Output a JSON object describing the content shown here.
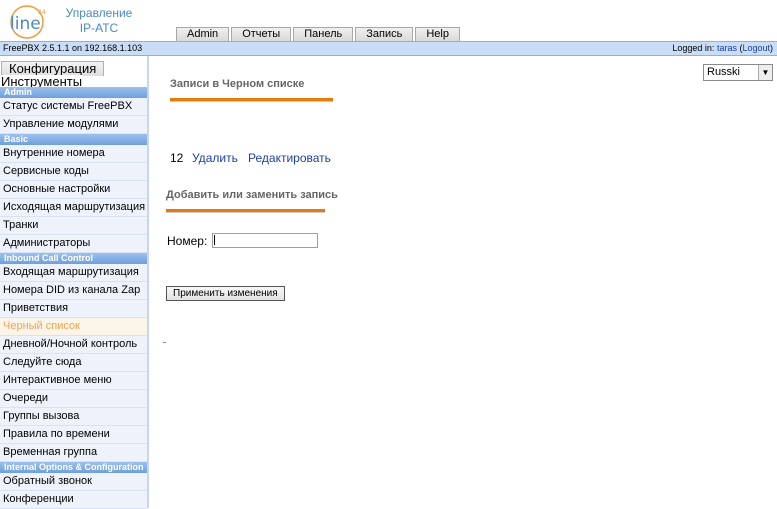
{
  "header": {
    "logo_text": "line",
    "logo_superscript": "24",
    "title_line1": "Управление",
    "title_line2": "IP-АТС",
    "tabs": [
      "Admin",
      "Отчеты",
      "Панель",
      "Запись",
      "Help"
    ]
  },
  "status_bar": {
    "version": "FreePBX 2.5.1.1 on 192.168.1.103",
    "logged_prefix": "Logged in:",
    "username": "taras",
    "logout_label": "Logout"
  },
  "sidebar": {
    "tab_config": "Конфигурация",
    "tab_tools": "Инструменты",
    "sections": [
      {
        "title": "Admin",
        "items": [
          "Статус системы FreePBX",
          "Управление модулями"
        ]
      },
      {
        "title": "Basic",
        "items": [
          "Внутренние номера",
          "Сервисные коды",
          "Основные настройки",
          "Исходящая маршрутизация",
          "Транки",
          "Администраторы"
        ]
      },
      {
        "title": "Inbound Call Control",
        "items": [
          "Входящая маршрутизация",
          "Номера DID из канала Zap",
          "Приветствия",
          "Черный список",
          "Дневной/Ночной контроль",
          "Следуйте сюда",
          "Интерактивное меню",
          "Очереди",
          "Группы вызова",
          "Правила по времени",
          "Временная группа"
        ]
      },
      {
        "title": "Internal Options & Configuration",
        "items": [
          "Обратный звонок",
          "Конференции"
        ]
      }
    ],
    "active_item": "Черный список"
  },
  "main": {
    "language": "Russki",
    "blacklist_title": "Записи в Черном списке",
    "entry_number": "12",
    "delete_label": "Удалить",
    "edit_label": "Редактировать",
    "add_title": "Добавить или заменить запись",
    "number_label": "Номер:",
    "number_value": "",
    "apply_label": "Применить изменения"
  },
  "colors": {
    "accent_orange": "#e87a0a",
    "band_blue": "#c9ddf6",
    "section_blue": "#7ea8e0",
    "link_blue": "#1c3fa8",
    "active_item": "#f2a452"
  }
}
